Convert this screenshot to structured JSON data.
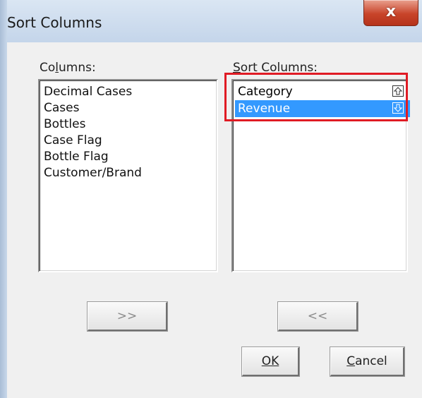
{
  "window": {
    "title": "Sort Columns",
    "close_label": "x"
  },
  "columns": {
    "label": "Columns:",
    "items": [
      "Decimal Cases",
      "Cases",
      "Bottles",
      "Case Flag",
      "Bottle Flag",
      "Customer/Brand"
    ]
  },
  "sort_columns": {
    "label": "Sort Columns:",
    "items": [
      {
        "name": "Category",
        "direction_icon": "sort-ascending-icon",
        "selected": false
      },
      {
        "name": "Revenue",
        "direction_icon": "sort-descending-icon",
        "selected": true
      }
    ]
  },
  "buttons": {
    "add_label": ">>",
    "remove_label": "<<",
    "ok_label": "OK",
    "cancel_label": "Cancel"
  },
  "colors": {
    "selection": "#3399ff",
    "highlight_box": "#e01b24"
  }
}
